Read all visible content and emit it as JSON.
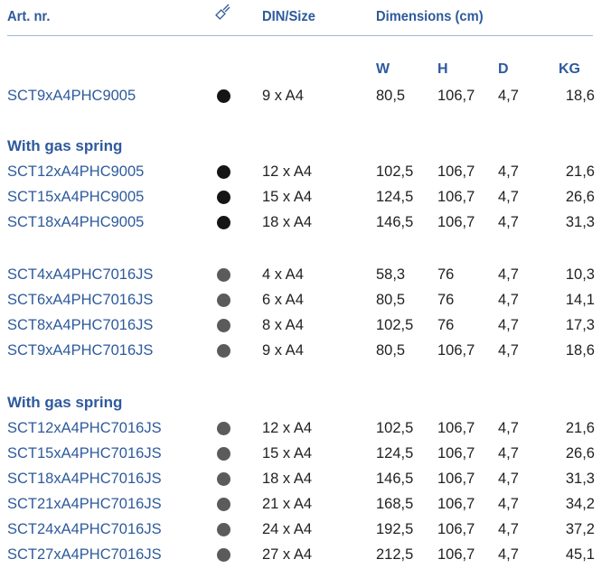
{
  "header": {
    "art_nr": "Art. nr.",
    "color_icon": "paint-brush-icon",
    "din_size": "DIN/Size",
    "dimensions": "Dimensions (cm)"
  },
  "subheader": {
    "w": "W",
    "h": "H",
    "d": "D",
    "kg": "KG"
  },
  "colors": {
    "heading_blue": "#2e5a9c",
    "black_dot": "#151515",
    "grey_dot": "#5b5b5b"
  },
  "groups": [
    {
      "section_title": "",
      "rows": [
        {
          "art": "SCT9xA4PHC9005",
          "color": "black",
          "size": "9 x A4",
          "w": "80,5",
          "h": "106,7",
          "d": "4,7",
          "kg": "18,6"
        }
      ]
    },
    {
      "section_title": "With gas spring",
      "rows": [
        {
          "art": "SCT12xA4PHC9005",
          "color": "black",
          "size": "12 x A4",
          "w": "102,5",
          "h": "106,7",
          "d": "4,7",
          "kg": "21,6"
        },
        {
          "art": "SCT15xA4PHC9005",
          "color": "black",
          "size": "15 x A4",
          "w": "124,5",
          "h": "106,7",
          "d": "4,7",
          "kg": "26,6"
        },
        {
          "art": "SCT18xA4PHC9005",
          "color": "black",
          "size": "18 x A4",
          "w": "146,5",
          "h": "106,7",
          "d": "4,7",
          "kg": "31,3"
        }
      ]
    },
    {
      "section_title": "",
      "rows": [
        {
          "art": "SCT4xA4PHC7016JS",
          "color": "grey",
          "size": "4 x A4",
          "w": "58,3",
          "h": "76",
          "d": "4,7",
          "kg": "10,3"
        },
        {
          "art": "SCT6xA4PHC7016JS",
          "color": "grey",
          "size": "6 x A4",
          "w": "80,5",
          "h": "76",
          "d": "4,7",
          "kg": "14,1"
        },
        {
          "art": "SCT8xA4PHC7016JS",
          "color": "grey",
          "size": "8 x A4",
          "w": "102,5",
          "h": "76",
          "d": "4,7",
          "kg": "17,3"
        },
        {
          "art": "SCT9xA4PHC7016JS",
          "color": "grey",
          "size": "9 x A4",
          "w": "80,5",
          "h": "106,7",
          "d": "4,7",
          "kg": "18,6"
        }
      ]
    },
    {
      "section_title": "With gas spring",
      "rows": [
        {
          "art": "SCT12xA4PHC7016JS",
          "color": "grey",
          "size": "12 x A4",
          "w": "102,5",
          "h": "106,7",
          "d": "4,7",
          "kg": "21,6"
        },
        {
          "art": "SCT15xA4PHC7016JS",
          "color": "grey",
          "size": "15 x A4",
          "w": "124,5",
          "h": "106,7",
          "d": "4,7",
          "kg": "26,6"
        },
        {
          "art": "SCT18xA4PHC7016JS",
          "color": "grey",
          "size": "18 x A4",
          "w": "146,5",
          "h": "106,7",
          "d": "4,7",
          "kg": "31,3"
        },
        {
          "art": "SCT21xA4PHC7016JS",
          "color": "grey",
          "size": "21 x A4",
          "w": "168,5",
          "h": "106,7",
          "d": "4,7",
          "kg": "34,2"
        },
        {
          "art": "SCT24xA4PHC7016JS",
          "color": "grey",
          "size": "24 x A4",
          "w": "192,5",
          "h": "106,7",
          "d": "4,7",
          "kg": "37,2"
        },
        {
          "art": "SCT27xA4PHC7016JS",
          "color": "grey",
          "size": "27 x A4",
          "w": "212,5",
          "h": "106,7",
          "d": "4,7",
          "kg": "45,1"
        }
      ]
    }
  ]
}
